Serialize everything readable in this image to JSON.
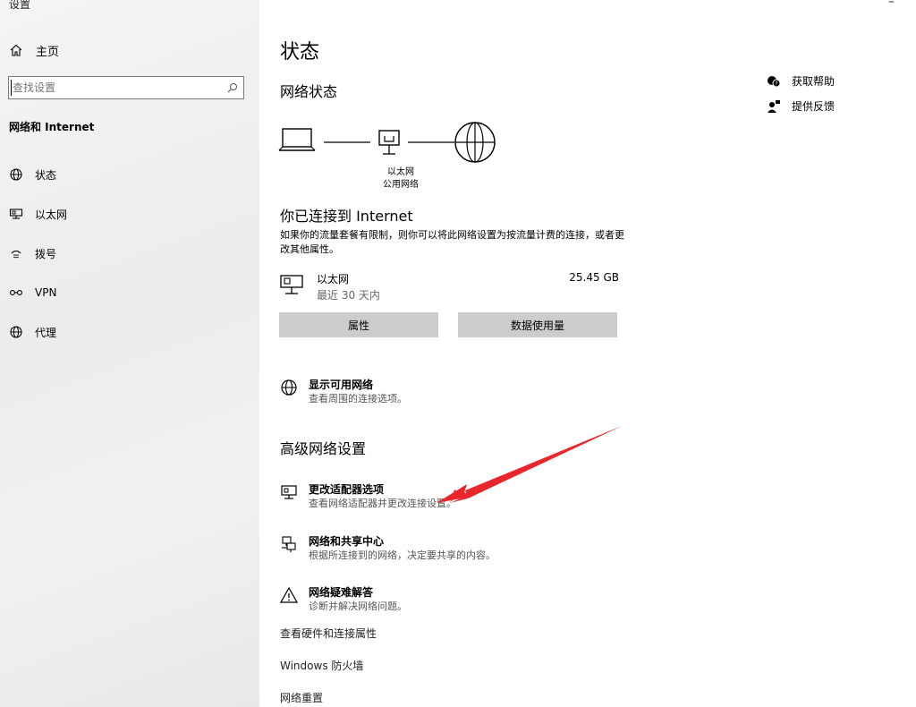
{
  "window": {
    "title": "设置",
    "minimize_glyph": "–"
  },
  "sidebar": {
    "home_label": "主页",
    "search_placeholder": "查找设置",
    "section_label": "网络和 Internet",
    "items": [
      {
        "label": "状态",
        "icon": "status-globe-icon"
      },
      {
        "label": "以太网",
        "icon": "ethernet-icon"
      },
      {
        "label": "拨号",
        "icon": "dialup-icon"
      },
      {
        "label": "VPN",
        "icon": "vpn-icon"
      },
      {
        "label": "代理",
        "icon": "proxy-globe-icon"
      }
    ]
  },
  "main": {
    "page_title": "状态",
    "network_status_heading": "网络状态",
    "diagram": {
      "adapter_label": "以太网",
      "network_type": "公用网络"
    },
    "connected_title": "你已连接到 Internet",
    "connected_desc": "如果你的流量套餐有限制，则你可以将此网络设置为按流量计费的连接，或者更改其他属性。",
    "ethernet": {
      "name": "以太网",
      "period": "最近 30 天内",
      "usage": "25.45 GB"
    },
    "buttons": {
      "properties": "属性",
      "data_usage": "数据使用量"
    },
    "show_networks": {
      "title": "显示可用网络",
      "subtitle": "查看周围的连接选项。"
    },
    "advanced_heading": "高级网络设置",
    "advanced_items": [
      {
        "title": "更改适配器选项",
        "subtitle": "查看网络适配器并更改连接设置。"
      },
      {
        "title": "网络和共享中心",
        "subtitle": "根据所连接到的网络，决定要共享的内容。"
      },
      {
        "title": "网络疑难解答",
        "subtitle": "诊断并解决网络问题。"
      }
    ],
    "plain_links": {
      "hardware": "查看硬件和连接属性",
      "firewall": "Windows 防火墙",
      "reset": "网络重置"
    },
    "help": {
      "get_help": "获取帮助",
      "feedback": "提供反馈"
    }
  },
  "colors": {
    "annotation_arrow": "#e8262b",
    "button_bg": "#cccccc"
  }
}
